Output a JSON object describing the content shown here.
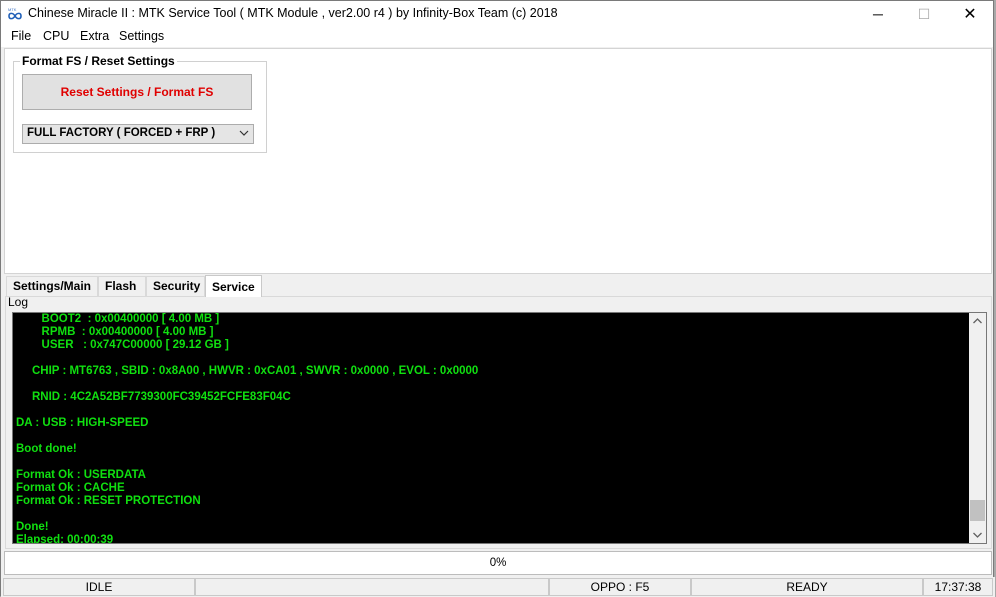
{
  "window": {
    "title": "Chinese Miracle II : MTK Service Tool ( MTK Module , ver2.00 r4  ) by Infinity-Box Team (c) 2018",
    "icon": "infinity-logo-icon",
    "controls": {
      "minimize": "─",
      "maximize": "☐",
      "close": "✕"
    }
  },
  "menu": [
    "File",
    "CPU",
    "Extra",
    "Settings"
  ],
  "format_group": {
    "title": "Format FS / Reset Settings",
    "reset_button": "Reset Settings / Format FS",
    "mode_selected": "FULL FACTORY ( FORCED + FRP )"
  },
  "tabs": [
    "Settings/Main",
    "Flash",
    "Security",
    "Service"
  ],
  "active_tab": "Service",
  "log": {
    "label": "Log",
    "lines": [
      "        BOOT2  : 0x00400000 [ 4.00 MB ]",
      "        RPMB  : 0x00400000 [ 4.00 MB ]",
      "        USER   : 0x747C00000 [ 29.12 GB ]",
      "",
      "     CHIP : MT6763 , SBID : 0x8A00 , HWVR : 0xCA01 , SWVR : 0x0000 , EVOL : 0x0000",
      "",
      "     RNID : 4C2A52BF7739300FC39452FCFE83F04C",
      "",
      "DA : USB : HIGH-SPEED",
      "",
      "Boot done!",
      "",
      "Format Ok : USERDATA",
      "Format Ok : CACHE",
      "Format Ok : RESET PROTECTION",
      "",
      "Done!",
      "Elapsed: 00:00:39"
    ],
    "text_color": "#10e010",
    "background": "#000000"
  },
  "progress": {
    "text": "0%",
    "value": 0
  },
  "status": {
    "state": "IDLE",
    "empty": "",
    "device": "OPPO : F5",
    "ready": "READY",
    "time": "17:37:38"
  }
}
